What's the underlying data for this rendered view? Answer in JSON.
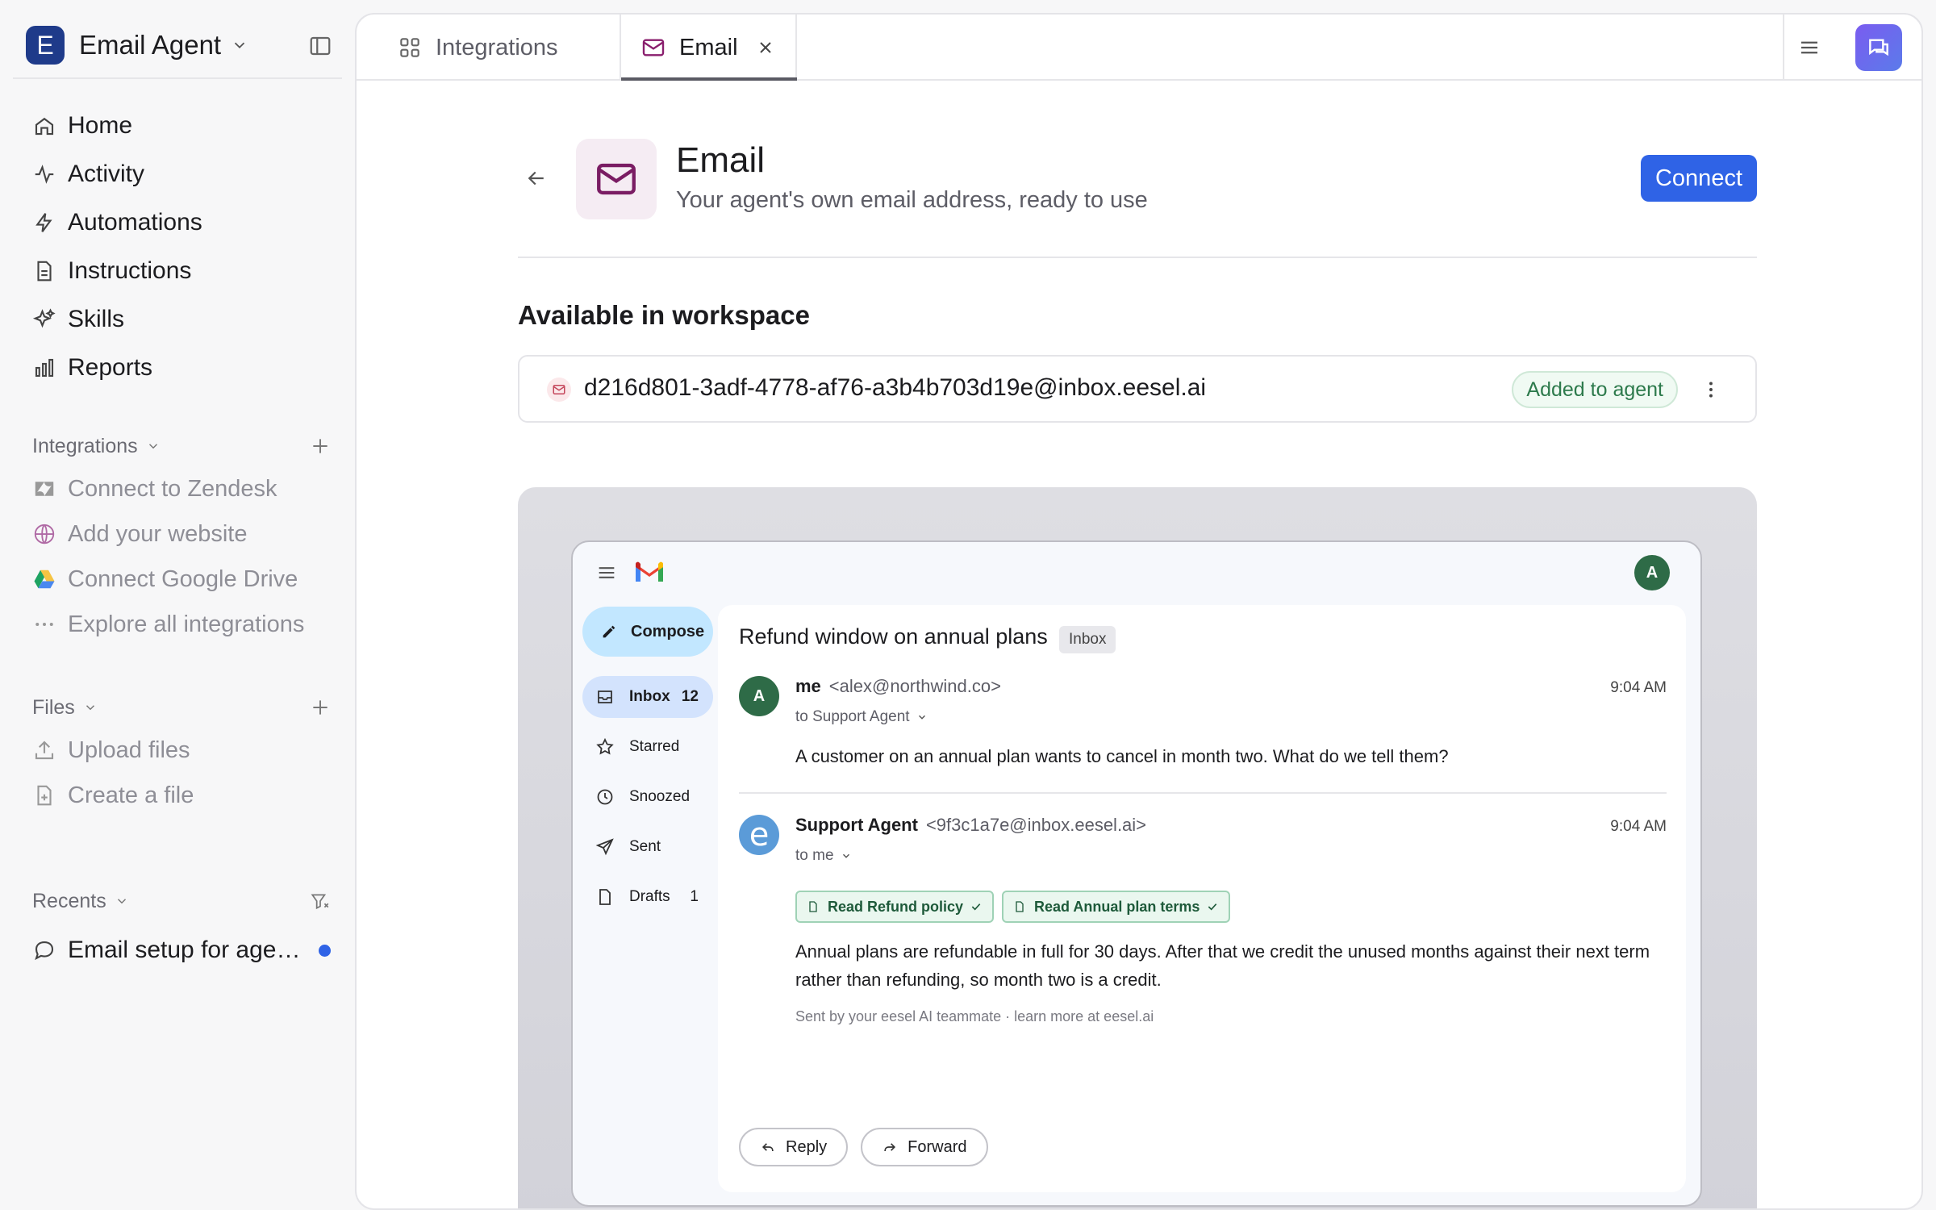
{
  "workspace": {
    "initial": "E",
    "name": "Email Agent",
    "logo_color": "#1f3b8a"
  },
  "nav": [
    {
      "label": "Home",
      "icon": "home-icon"
    },
    {
      "label": "Activity",
      "icon": "activity-icon"
    },
    {
      "label": "Automations",
      "icon": "lightning-icon"
    },
    {
      "label": "Instructions",
      "icon": "document-icon"
    },
    {
      "label": "Skills",
      "icon": "sparkles-icon"
    },
    {
      "label": "Reports",
      "icon": "bar-chart-icon"
    }
  ],
  "integrations_section": {
    "title": "Integrations",
    "items": [
      {
        "label": "Connect to Zendesk",
        "icon": "zendesk-icon"
      },
      {
        "label": "Add your website",
        "icon": "globe-icon"
      },
      {
        "label": "Connect Google Drive",
        "icon": "google-drive-icon"
      },
      {
        "label": "Explore all integrations",
        "icon": "ellipsis-icon"
      }
    ]
  },
  "files_section": {
    "title": "Files",
    "items": [
      {
        "label": "Upload files",
        "icon": "upload-icon"
      },
      {
        "label": "Create a file",
        "icon": "new-file-icon"
      }
    ]
  },
  "recents_section": {
    "title": "Recents",
    "items": [
      {
        "label": "Email setup for agen...",
        "icon": "chat-bubble-icon",
        "unread_color": "#2f63e6"
      }
    ]
  },
  "tabs": [
    {
      "label": "Integrations",
      "icon": "grid-icon"
    },
    {
      "label": "Email",
      "icon": "mail-icon",
      "active": true
    }
  ],
  "integration": {
    "title": "Email",
    "subtitle": "Your agent's own email address, ready to use",
    "connect_label": "Connect",
    "accent": "#2f63e6",
    "available_heading": "Available in workspace",
    "address": "d216d801-3adf-4778-af76-a3b4b703d19e@inbox.eesel.ai",
    "address_status": "Added to agent"
  },
  "gmail": {
    "avatar_initial": "A",
    "compose_label": "Compose",
    "folders": [
      {
        "label": "Inbox",
        "count": "12",
        "icon": "inbox-icon",
        "active": true
      },
      {
        "label": "Starred",
        "count": "",
        "icon": "star-icon"
      },
      {
        "label": "Snoozed",
        "count": "",
        "icon": "clock-icon"
      },
      {
        "label": "Sent",
        "count": "",
        "icon": "send-icon"
      },
      {
        "label": "Drafts",
        "count": "1",
        "icon": "draft-icon"
      }
    ],
    "thread": {
      "subject": "Refund window on annual plans",
      "label": "Inbox",
      "messages": [
        {
          "avatar": "A",
          "sender_name": "me",
          "sender_addr": "<alex@northwind.co>",
          "time": "9:04 AM",
          "to": "to Support Agent",
          "body": "A customer on an annual plan wants to cancel in month two. What do we tell them?"
        },
        {
          "avatar": "e",
          "sender_name": "Support Agent",
          "sender_addr": "<9f3c1a7e@inbox.eesel.ai>",
          "time": "9:04 AM",
          "to": "to me",
          "chips": [
            "Read Refund policy",
            "Read Annual plan terms"
          ],
          "body": "Annual plans are refundable in full for 30 days. After that we credit the unused months against their next term rather than refunding, so month two is a credit.",
          "footer": "Sent by your eesel AI teammate · learn more at eesel.ai"
        }
      ]
    },
    "reply_label": "Reply",
    "forward_label": "Forward"
  }
}
